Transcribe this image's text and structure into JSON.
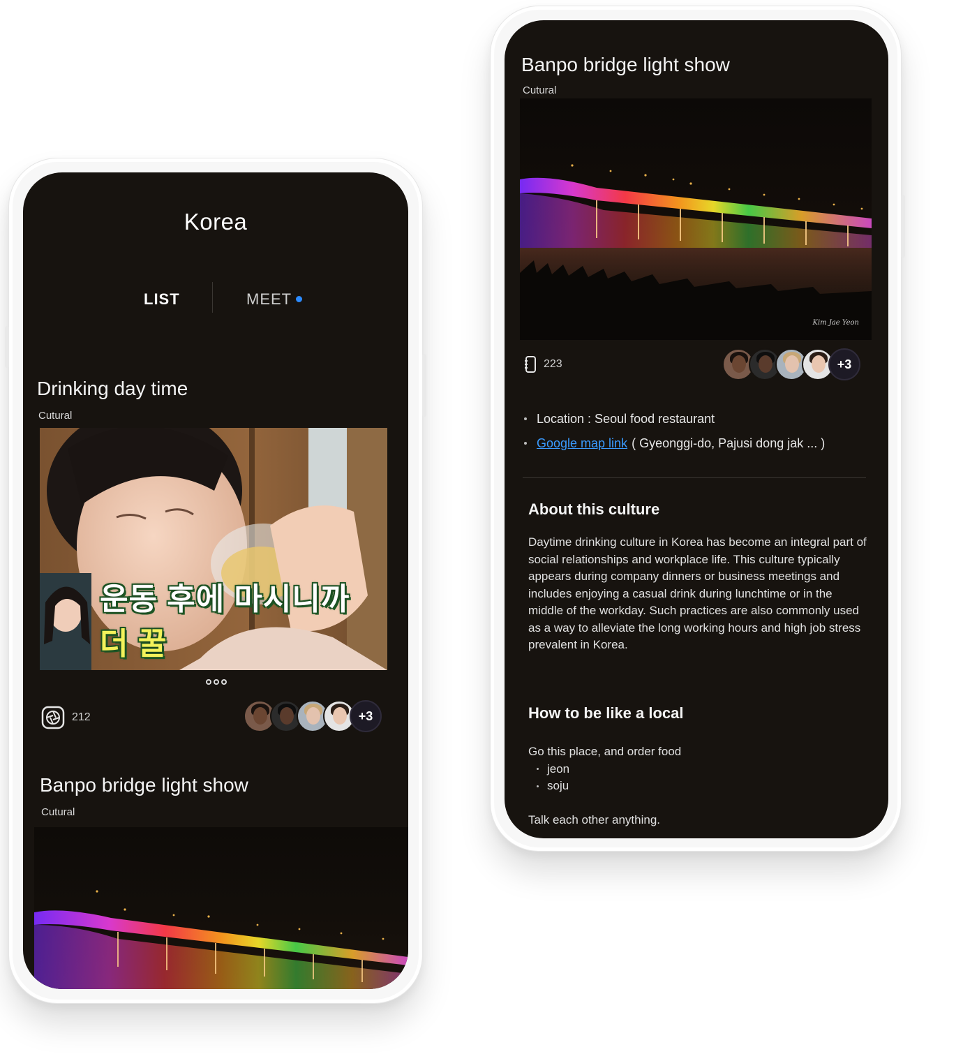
{
  "left_screen": {
    "title": "Korea",
    "tabs": [
      {
        "label": "LIST",
        "active": true
      },
      {
        "label": "MEET",
        "active": false,
        "badge_color": "#2c8bff"
      }
    ],
    "cards": [
      {
        "title": "Drinking day time",
        "category": "Cutural",
        "image_caption": {
          "white": "운동 후에 마시니까 ",
          "yellow": "더 꿀"
        },
        "stat_icon": "aperture-icon",
        "count": "212",
        "more_participants": "+3"
      },
      {
        "title": "Banpo bridge light show",
        "category": "Cutural"
      }
    ]
  },
  "right_screen": {
    "title": "Banpo bridge light show",
    "category": "Cutural",
    "photo_watermark": "Kim Jae Yeon",
    "stat_icon": "notebook-icon",
    "count": "223",
    "more_participants": "+3",
    "location_label": "Location : Seoul food restaurant",
    "map_link_label": "Google map link",
    "map_link_address": "( Gyeonggi-do, Pajusi dong jak ... )",
    "about_heading": "About this culture",
    "about_text": "Daytime drinking culture in Korea has become an integral part of social relationships and workplace life. This culture typically appears during company dinners or business meetings and includes enjoying a casual drink during lunchtime or in the middle of the workday. Such practices are also commonly used as a way to alleviate the long working hours and high job stress prevalent in Korea.",
    "local_heading": "How to be like a local",
    "local_intro": "Go this place, and order food",
    "local_items": [
      "jeon",
      "soju"
    ],
    "local_outro": "Talk each other anything."
  },
  "colors": {
    "screen_bg": "#17130f",
    "accent_blue": "#2c8bff",
    "link_blue": "#3a9bff"
  }
}
